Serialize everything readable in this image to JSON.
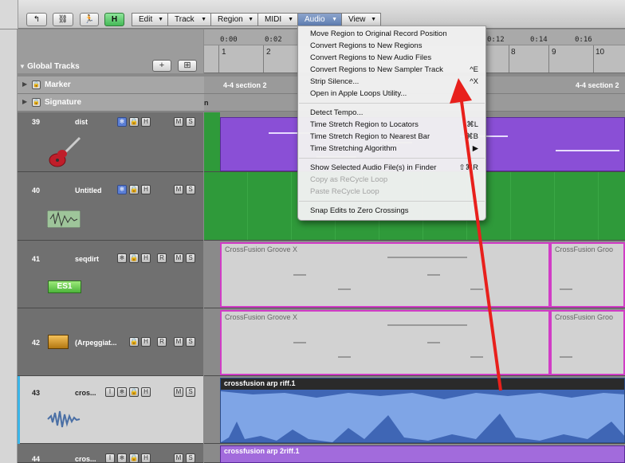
{
  "toolbar": {
    "menus": [
      {
        "label": "Edit",
        "open": false
      },
      {
        "label": "Track",
        "open": false
      },
      {
        "label": "Region",
        "open": false
      },
      {
        "label": "MIDI",
        "open": false
      },
      {
        "label": "Audio",
        "open": true
      },
      {
        "label": "View",
        "open": false
      }
    ],
    "h_button": "H"
  },
  "global": {
    "title": "Global Tracks",
    "add_label": "+",
    "rows": [
      {
        "name": "Marker",
        "section": "4-4 section 2"
      },
      {
        "name": "Signature",
        "section": ""
      }
    ],
    "marker_section_right": "4-4 section 2",
    "signature_fragment": "n"
  },
  "ruler": {
    "timecodes": [
      "0:00",
      "0:02",
      "0:12",
      "0:14",
      "0:16"
    ],
    "bars": [
      "1",
      "2",
      "8",
      "9",
      "10"
    ]
  },
  "tracks": [
    {
      "num": "39",
      "name": "dist"
    },
    {
      "num": "40",
      "name": "Untitled"
    },
    {
      "num": "41",
      "name": "seqdirt",
      "instrument": "ES1"
    },
    {
      "num": "42",
      "name": "(Arpeggiat..."
    },
    {
      "num": "43",
      "name": "cros..."
    },
    {
      "num": "44",
      "name": "cros..."
    }
  ],
  "regions": {
    "groove_a": "CrossFusion Groove X",
    "groove_b": "CrossFusion Groo",
    "audio_a": "crossfusion arp riff.1",
    "audio_b": "crossfusion arp 2riff.1"
  },
  "audio_menu": {
    "items": [
      {
        "label": "Move Region to Original Record Position",
        "shortcut": "",
        "enabled": true
      },
      {
        "label": "Convert Regions to New Regions",
        "shortcut": "",
        "enabled": true
      },
      {
        "label": "Convert Regions to New Audio Files",
        "shortcut": "",
        "enabled": true
      },
      {
        "label": "Convert Regions to New Sampler Track",
        "shortcut": "^E",
        "enabled": true
      },
      {
        "label": "Strip Silence...",
        "shortcut": "^X",
        "enabled": true
      },
      {
        "label": "Open in Apple Loops Utility...",
        "shortcut": "",
        "enabled": true
      },
      {
        "label": "Detect Tempo...",
        "shortcut": "",
        "enabled": true
      },
      {
        "label": "Time Stretch Region to Locators",
        "shortcut": "⌘L",
        "enabled": true
      },
      {
        "label": "Time Stretch Region to Nearest Bar",
        "shortcut": "⌘B",
        "enabled": true
      },
      {
        "label": "Time Stretching Algorithm",
        "shortcut": "▶",
        "enabled": true
      },
      {
        "label": "Show Selected Audio File(s) in Finder",
        "shortcut": "⇧⌘R",
        "enabled": true
      },
      {
        "label": "Copy as ReCycle Loop",
        "shortcut": "",
        "enabled": false
      },
      {
        "label": "Paste ReCycle Loop",
        "shortcut": "",
        "enabled": false
      },
      {
        "label": "Snap Edits to Zero Crossings",
        "shortcut": "",
        "enabled": true
      }
    ]
  },
  "colors": {
    "purple": "#8a4fd6",
    "green": "#2f9a3a",
    "grey_region": "#d2d2d2",
    "audio_blue": "#7fa5e6",
    "pink_border": "#d13cc6",
    "arrow_red": "#e8201c"
  },
  "icons": [
    "back-icon",
    "link-icon",
    "running-man-icon",
    "guitar-icon",
    "waveform-icon",
    "synth-icon",
    "waveform-icon",
    "lock-icon",
    "disclosure-triangle-icon"
  ]
}
